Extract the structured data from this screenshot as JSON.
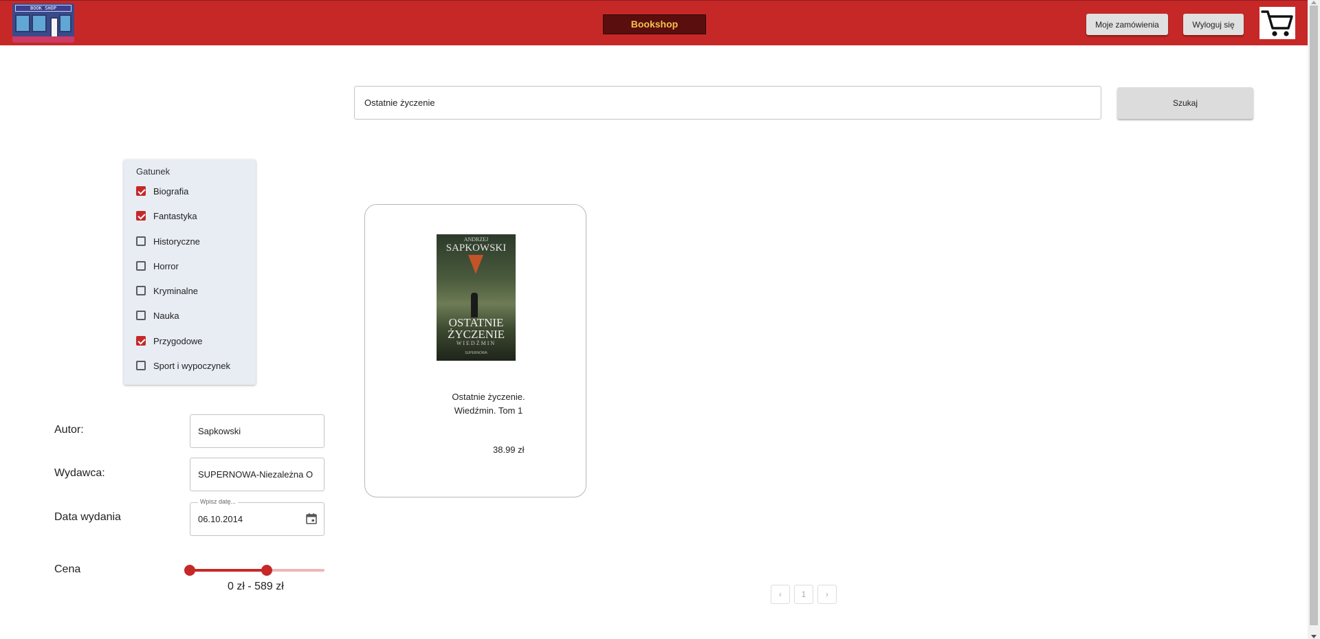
{
  "header": {
    "logo_text": "BOOK SHOP",
    "brand": "Bookshop",
    "orders_button": "Moje zamówienia",
    "logout_button": "Wyloguj się"
  },
  "search": {
    "value": "Ostatnie życzenie",
    "button_label": "Szukaj"
  },
  "filters": {
    "genre_title": "Gatunek",
    "genres": [
      {
        "label": "Biografia",
        "checked": true
      },
      {
        "label": "Fantastyka",
        "checked": true
      },
      {
        "label": "Historyczne",
        "checked": false
      },
      {
        "label": "Horror",
        "checked": false
      },
      {
        "label": "Kryminalne",
        "checked": false
      },
      {
        "label": "Nauka",
        "checked": false
      },
      {
        "label": "Przygodowe",
        "checked": true
      },
      {
        "label": "Sport i wypoczynek",
        "checked": false
      }
    ],
    "author_label": "Autor:",
    "author_value": "Sapkowski",
    "publisher_label": "Wydawca:",
    "publisher_value": "SUPERNOWA-Niezależna O",
    "date_label": "Data wydania",
    "date_legend": "Wpisz datę...",
    "date_value": "06.10.2014",
    "price_label": "Cena",
    "price_range_text": "0 zł - 589 zł",
    "price_slider": {
      "min_fraction": 0.0,
      "max_fraction": 0.57
    }
  },
  "products": [
    {
      "title_line1": "Ostatnie życzenie.",
      "title_line2": "Wiedźmin. Tom 1",
      "price": "38.99 zł",
      "cover": {
        "author_small": "ANDRZEJ",
        "author": "SAPKOWSKI",
        "title_line1": "OSTATNIE",
        "title_line2": "ŻYCZENIE",
        "series": "WIEDŹMIN",
        "publisher": "SUPERNOWA"
      }
    }
  ],
  "pagination": {
    "prev": "‹",
    "current": "1",
    "next": "›"
  },
  "colors": {
    "accent": "#c62828",
    "brand_bg": "#5b0e0e",
    "brand_text": "#f4c24d",
    "filter_panel": "#e8edf4"
  }
}
